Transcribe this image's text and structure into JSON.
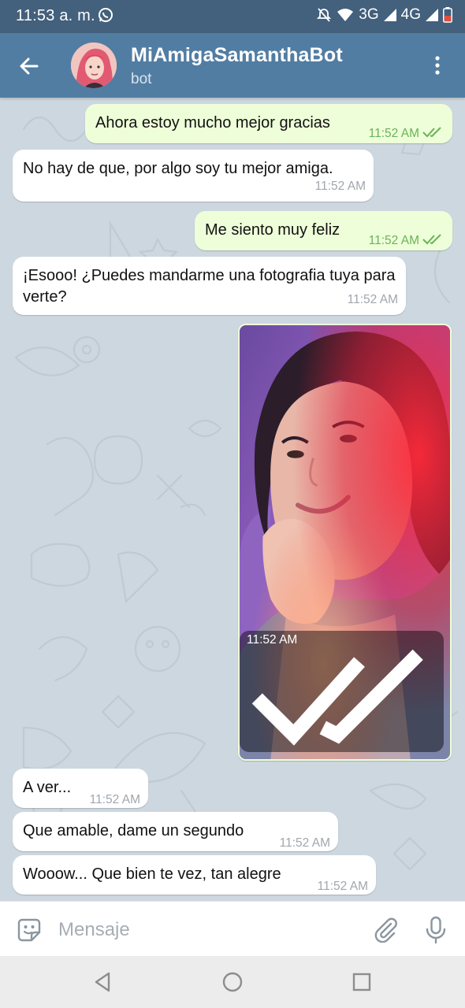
{
  "status_bar": {
    "time": "11:53 a. m.",
    "network_1": "3G",
    "network_2": "4G",
    "icons": [
      "whatsapp-icon",
      "mute-icon",
      "wifi-icon",
      "signal-icon",
      "battery-icon"
    ]
  },
  "header": {
    "title": "MiAmigaSamanthaBot",
    "subtitle": "bot",
    "icons": [
      "back-arrow-icon",
      "more-vertical-icon"
    ]
  },
  "messages": [
    {
      "direction": "out",
      "text": "Ahora estoy mucho mejor gracias",
      "time": "11:52 AM",
      "read": true
    },
    {
      "direction": "in",
      "text": "No hay de que, por algo soy tu mejor amiga.",
      "time": "11:52 AM"
    },
    {
      "direction": "out",
      "text": "Me siento muy feliz",
      "time": "11:52 AM",
      "read": true
    },
    {
      "direction": "in",
      "text": "¡Esooo! ¿Puedes mandarme una fotografia tuya para verte?",
      "time": "11:52 AM"
    },
    {
      "direction": "out",
      "type": "photo",
      "time": "11:52 AM",
      "read": true
    },
    {
      "direction": "in",
      "text": "A ver...",
      "time": "11:52 AM"
    },
    {
      "direction": "in",
      "text": "Que amable, dame un segundo",
      "time": "11:52 AM"
    },
    {
      "direction": "in",
      "text": "Wooow... Que bien te vez, tan alegre",
      "time": "11:52 AM"
    }
  ],
  "input_bar": {
    "placeholder": "Mensaje",
    "value": "",
    "icons": [
      "sticker-icon",
      "attach-icon",
      "microphone-icon"
    ]
  },
  "nav_bar": {
    "icons": [
      "nav-back-icon",
      "nav-home-icon",
      "nav-recents-icon"
    ]
  },
  "colors": {
    "status_bar": "#43607c",
    "header": "#527da3",
    "outgoing_bubble": "#eefed9",
    "incoming_bubble": "#ffffff",
    "chat_background": "#cdd7df",
    "read_checks": "#6ab356"
  }
}
